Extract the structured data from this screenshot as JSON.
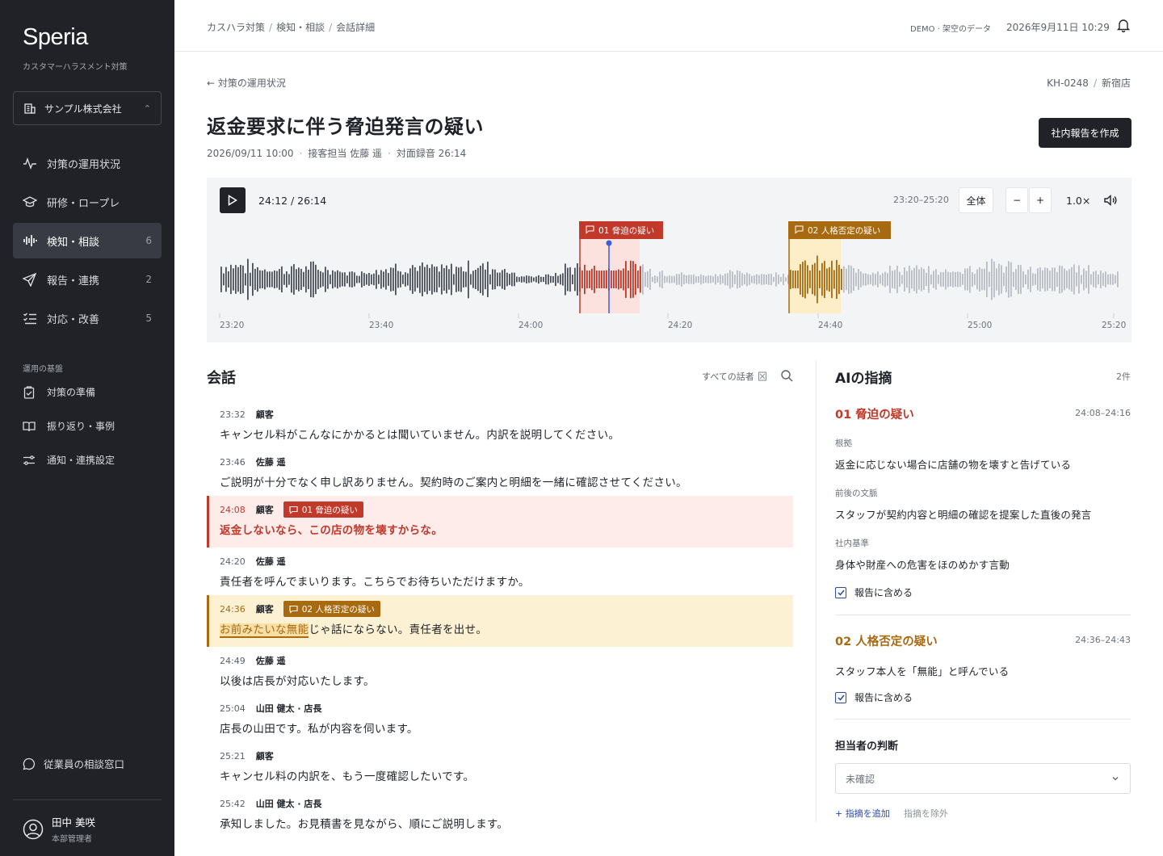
{
  "app": {
    "brand": "Speria",
    "subtitle": "カスタマーハラスメント対策"
  },
  "org": {
    "name": "サンプル株式会社"
  },
  "nav": [
    {
      "label": "対策の運用状況",
      "count": ""
    },
    {
      "label": "研修・ロープレ",
      "count": ""
    },
    {
      "label": "検知・相談",
      "count": "6"
    },
    {
      "label": "報告・連携",
      "count": "2"
    },
    {
      "label": "対応・改善",
      "count": "5"
    }
  ],
  "foundation": {
    "label": "運用の基盤",
    "items": [
      {
        "label": "対策の準備"
      },
      {
        "label": "振り返り・事例"
      },
      {
        "label": "通知・連携設定"
      }
    ]
  },
  "consult": {
    "label": "従業員の相談窓口"
  },
  "user": {
    "name": "田中 美咲",
    "role": "本部管理者"
  },
  "header": {
    "breadcrumb": [
      "カスハラ対策",
      "検知・相談",
      "会話詳細"
    ],
    "demo": "DEMO · 架空のデータ",
    "datetime": "2026年9月11日 10:29"
  },
  "page": {
    "back": "対策の運用状況",
    "case_id": "KH-0248",
    "store": "新宿店",
    "title": "返金要求に伴う脅迫発言の疑い",
    "meta": [
      "2026/09/11 10:00",
      "接客担当 佐藤 遥",
      "対面録音 26:14"
    ],
    "report_button": "社内報告を作成"
  },
  "player": {
    "time": "24:12 / 26:14",
    "range": "23:20–25:20",
    "all_label": "全体",
    "zoom_out": "−",
    "zoom_in": "+",
    "speed": "1.0×",
    "markers": [
      {
        "label": "01 脅迫の疑い",
        "color": "#c0392b"
      },
      {
        "label": "02 人格否定の疑い",
        "color": "#a86a10"
      }
    ],
    "ticks": [
      "23:20",
      "23:40",
      "24:00",
      "24:20",
      "24:40",
      "25:00",
      "25:20"
    ],
    "colors": {
      "played": "#4a4e56",
      "unplayed": "#b8bcc3",
      "red": "#c0392b",
      "yellow": "#a86a10",
      "red_bg": "#fbe2df",
      "yellow_bg": "#fdeec8",
      "playhead": "#3b5bdb"
    }
  },
  "conversation": {
    "title": "会話",
    "filter": "すべての話者",
    "messages": [
      {
        "time": "23:32",
        "speaker": "顧客",
        "text": "キャンセル料がこんなにかかるとは聞いていません。内訳を説明してください。"
      },
      {
        "time": "23:46",
        "speaker": "佐藤 遥",
        "text": "ご説明が十分でなく申し訳ありません。契約時のご案内と明細を一緒に確認させてください。"
      },
      {
        "time": "24:08",
        "speaker": "顧客",
        "tag": "01 脅迫の疑い",
        "text": "返金しないなら、この店の物を壊すからな。"
      },
      {
        "time": "24:20",
        "speaker": "佐藤 遥",
        "text": "責任者を呼んでまいります。こちらでお待ちいただけますか。"
      },
      {
        "time": "24:36",
        "speaker": "顧客",
        "tag": "02 人格否定の疑い",
        "text_hl": "お前みたいな無能",
        "text_rest": "じゃ話にならない。責任者を出せ。"
      },
      {
        "time": "24:49",
        "speaker": "佐藤 遥",
        "text": "以後は店長が対応いたします。"
      },
      {
        "time": "25:04",
        "speaker": "山田 健太 · 店長",
        "text": "店長の山田です。私が内容を伺います。"
      },
      {
        "time": "25:21",
        "speaker": "顧客",
        "text": "キャンセル料の内訳を、もう一度確認したいです。"
      },
      {
        "time": "25:42",
        "speaker": "山田 健太 · 店長",
        "text": "承知しました。お見積書を見ながら、順にご説明します。"
      }
    ]
  },
  "ai": {
    "title": "AIの指摘",
    "count": "2件",
    "findings": [
      {
        "title": "01 脅迫の疑い",
        "range": "24:08–24:16",
        "basis_label": "根拠",
        "basis": "返金に応じない場合に店舗の物を壊すと告げている",
        "context_label": "前後の文脈",
        "context": "スタッフが契約内容と明細の確認を提案した直後の発言",
        "standard_label": "社内基準",
        "standard": "身体や財産への危害をほのめかす言動",
        "include": "報告に含める"
      },
      {
        "title": "02 人格否定の疑い",
        "range": "24:36–24:43",
        "basis": "スタッフ本人を「無能」と呼んでいる",
        "include": "報告に含める"
      }
    ],
    "judgment_title": "担当者の判断",
    "judgment_value": "未確認",
    "add": "+ 指摘を追加",
    "exclude": "指摘を除外"
  }
}
